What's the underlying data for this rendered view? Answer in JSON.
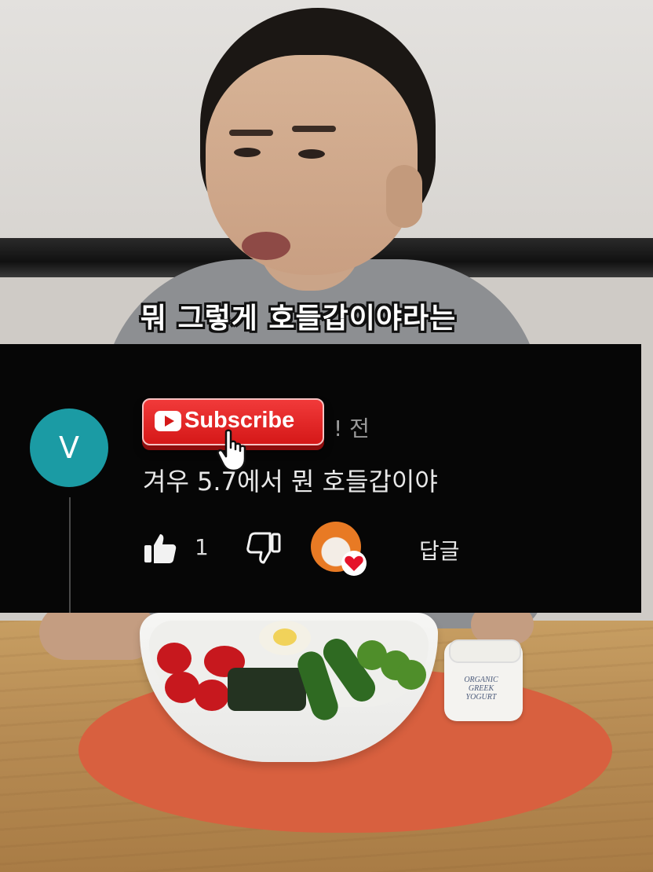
{
  "video": {
    "subtitle": "뭐 그렇게 호들갑이야라는"
  },
  "comment": {
    "avatar_letter": "V",
    "time_suffix": "! 전",
    "text": "겨우 5.7에서 뭔 호들갑이야",
    "like_count": "1",
    "reply_label": "답글",
    "creator_hearted": true
  },
  "subscribe_overlay": {
    "label": "Subscribe"
  },
  "jar": {
    "label_line1": "ORGANIC",
    "label_line2": "GREEK",
    "label_line3": "YOGURT"
  },
  "colors": {
    "avatar_bg": "#1b9ba4",
    "subscribe_red": "#d51818",
    "comment_bg": "#060606"
  },
  "icons": [
    "thumbs-up-icon",
    "thumbs-down-icon",
    "heart-icon",
    "youtube-play-icon",
    "hand-cursor-icon"
  ]
}
